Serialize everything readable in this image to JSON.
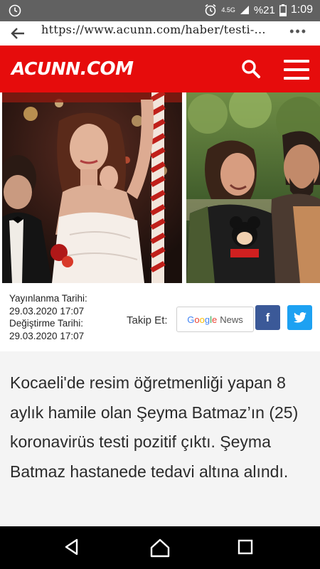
{
  "status_bar": {
    "network": "4.5G",
    "battery": "%21",
    "time": "1:09"
  },
  "browser": {
    "url": "https://www.acunn.com/haber/testi-...",
    "more": "•••"
  },
  "site": {
    "logo_text": "ACUNN",
    "logo_suffix": ".COM",
    "brand_color": "#e60c0c"
  },
  "meta": {
    "published_label": "Yayınlanma Tarihi:",
    "published_date": "29.03.2020 17:07",
    "modified_label": "Değiştirme Tarihi:",
    "modified_date": "29.03.2020 17:07",
    "follow_label": "Takip Et:",
    "google_news": {
      "g1": "G",
      "g2": "o",
      "g3": "o",
      "g4": "g",
      "g5": "l",
      "g6": "e",
      "suffix": "News"
    },
    "facebook_glyph": "f"
  },
  "article": {
    "text": "Kocaeli'de resim öğretmenliği yapan 8 aylık hamile olan Şeyma Batmaz’ın (25) koronavirüs testi pozitif çıktı. Şeyma Batmaz hastanede tedavi altına alındı."
  }
}
